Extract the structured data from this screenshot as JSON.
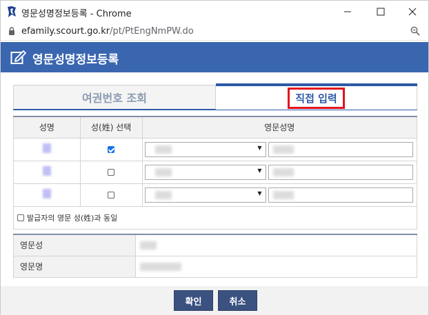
{
  "window": {
    "title": "영문성명정보등록 - Chrome"
  },
  "address": {
    "host": "efamily.scourt.go.kr",
    "path": "/pt/PtEngNmPW.do"
  },
  "header": {
    "title": "영문성명정보등록"
  },
  "tabs": [
    {
      "label": "여권번호 조회",
      "active": false
    },
    {
      "label": "직접 입력",
      "active": true
    }
  ],
  "table": {
    "headers": [
      "성명",
      "성(姓) 선택",
      "영문성명"
    ],
    "rows": [
      {
        "surname_checked": true
      },
      {
        "surname_checked": false
      },
      {
        "surname_checked": false
      }
    ],
    "same_as_issuer_label": "발급자의 영문 성(姓)과 동일"
  },
  "summary": {
    "surname_label": "영문성",
    "given_label": "영문명"
  },
  "buttons": {
    "ok": "확인",
    "cancel": "취소"
  },
  "colors": {
    "header_bg": "#3a66b0",
    "active_tab_text": "#2d5aa6",
    "highlight_box": "#e3101c",
    "button_bg": "#3b5180"
  }
}
